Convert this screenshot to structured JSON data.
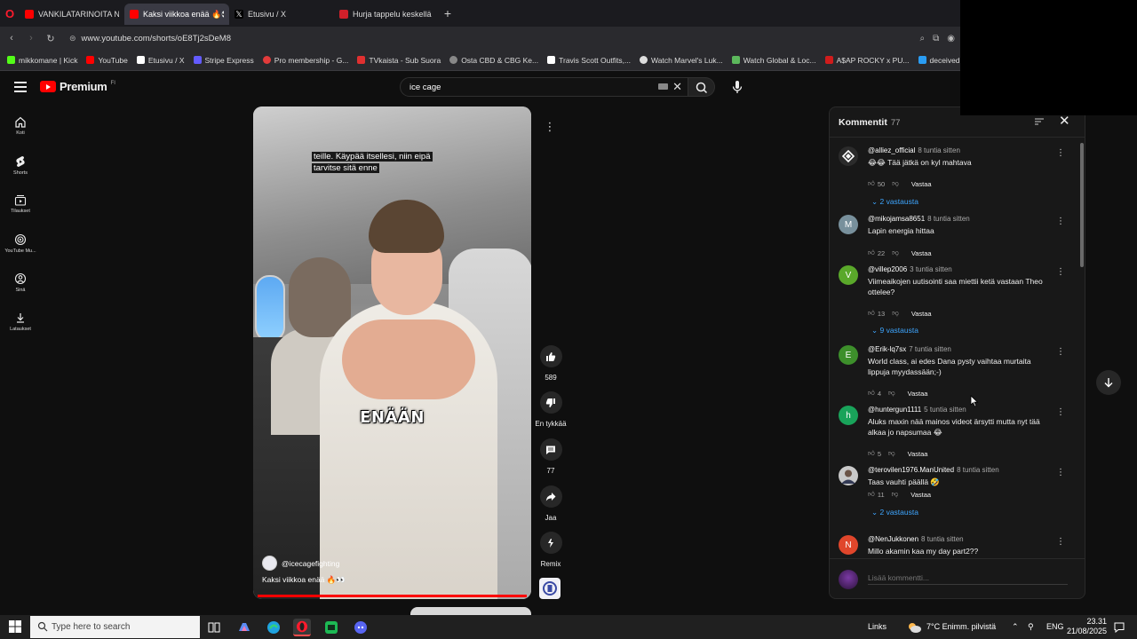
{
  "browser": {
    "tabs": [
      {
        "title": "VANKILATARINOITA NRO",
        "active": false,
        "favicon_color": "#ff0000"
      },
      {
        "title": "Kaksi viikkoa enää 🔥👀",
        "active": true,
        "favicon_color": "#ff0000"
      },
      {
        "title": "Etusivu / X",
        "active": false,
        "favicon_color": "#ffffff"
      },
      {
        "title": "Hurja tappelu keskellä He",
        "active": false,
        "favicon_color": "#d0202a"
      }
    ],
    "url": "www.youtube.com/shorts/oE8Tj2sDeM8",
    "bookmarks": [
      {
        "label": "mikkomane | Kick",
        "color": "#53fc18"
      },
      {
        "label": "YouTube",
        "color": "#ff0000"
      },
      {
        "label": "Etusivu / X",
        "color": "#ffffff"
      },
      {
        "label": "Stripe Express",
        "color": "#635bff"
      },
      {
        "label": "Pro membership - G...",
        "color": "#e33b3b"
      },
      {
        "label": "TVkaista - Sub Suora",
        "color": "#e03030"
      },
      {
        "label": "Osta CBD & CBG Ke...",
        "color": "#888888"
      },
      {
        "label": "Travis Scott Outfits,...",
        "color": "#ffffff"
      },
      {
        "label": "Watch Marvel's Luk...",
        "color": "#dddddd"
      },
      {
        "label": "Watch Global & Loc...",
        "color": "#5cb85c"
      },
      {
        "label": "A$AP ROCKY x PU...",
        "color": "#d01c1c"
      },
      {
        "label": "deceived – SUORAT...",
        "color": "#2a9df4"
      }
    ]
  },
  "youtube": {
    "logo_text": "Premium",
    "country_code": "FI",
    "search_value": "ice cage",
    "sidebar": [
      {
        "label": "Koti",
        "icon": "home-icon"
      },
      {
        "label": "Shorts",
        "icon": "shorts-icon"
      },
      {
        "label": "Tilaukset",
        "icon": "subscriptions-icon"
      },
      {
        "label": "YouTube Mu...",
        "icon": "youtube-music-icon"
      },
      {
        "label": "Sinä",
        "icon": "you-icon"
      },
      {
        "label": "Lataukset",
        "icon": "downloads-icon"
      }
    ]
  },
  "video": {
    "caption_top": "teille. Käypää itsellesi, niin eipä tarvitse sitä enne",
    "caption_center": "ENÄÄN",
    "channel": "@icecagefighting",
    "title": "Kaksi viikkoa enää 🔥👀"
  },
  "actions": {
    "like_count": "589",
    "dislike_label": "En tykkää",
    "comment_count": "77",
    "share_label": "Jaa",
    "remix_label": "Remix"
  },
  "comments_panel": {
    "title": "Kommentit",
    "count": "77",
    "reply_label": "Vastaa",
    "add_placeholder": "Lisää kommentti...",
    "items": [
      {
        "user": "@alliez_official",
        "time": "8 tuntia sitten",
        "text": "😂😂 Tää jätkä on kyl mahtava",
        "likes": "50",
        "replies": "2 vastausta",
        "avatar_letter": "",
        "avatar_color": "#2b2b2b"
      },
      {
        "user": "@mikojamsa8651",
        "time": "8 tuntia sitten",
        "text": "Lapin energia hittaa",
        "likes": "22",
        "replies": "",
        "avatar_letter": "M",
        "avatar_color": "#78909c"
      },
      {
        "user": "@villep2006",
        "time": "3 tuntia sitten",
        "text": "Viimeaikojen uutisointi saa miettii ketä vastaan Theo ottelee?",
        "likes": "13",
        "replies": "9 vastausta",
        "avatar_letter": "V",
        "avatar_color": "#5aa82a"
      },
      {
        "user": "@Erik-lq7sx",
        "time": "7 tuntia sitten",
        "text": "World class, ai edes Dana pysty vaihtaa murtaita lippuja myydassään;-)",
        "likes": "4",
        "replies": "",
        "avatar_letter": "E",
        "avatar_color": "#3d8f2b"
      },
      {
        "user": "@huntergun1111",
        "time": "5 tuntia sitten",
        "text": "Aluks maxin nää mainos videot ärsytti mutta nyt tää alkaa jo napsumaa 😂",
        "likes": "5",
        "replies": "",
        "avatar_letter": "h",
        "avatar_color": "#19a35a"
      },
      {
        "user": "@terovilen1976.ManUnited",
        "time": "8 tuntia sitten",
        "text": "Taas vauhti päällä 🤣",
        "likes": "11",
        "replies": "2 vastausta",
        "avatar_letter": "",
        "avatar_color": "#c9c9c9"
      },
      {
        "user": "@NenJukkonen",
        "time": "8 tuntia sitten",
        "text": "Millo akamin kaa my day part2??",
        "likes": "",
        "replies": "",
        "avatar_letter": "N",
        "avatar_color": "#e0462b"
      }
    ]
  },
  "taskbar": {
    "search_placeholder": "Type here to search",
    "links_label": "Links",
    "weather": "7°C Enimm. pilvistä",
    "language": "ENG",
    "time": "23.31",
    "date": "21/08/2025"
  },
  "colors": {
    "accent_link": "#3ea6ff",
    "youtube_red": "#ff0000",
    "panel_bg": "#181818",
    "page_bg": "#0f0f0f"
  }
}
